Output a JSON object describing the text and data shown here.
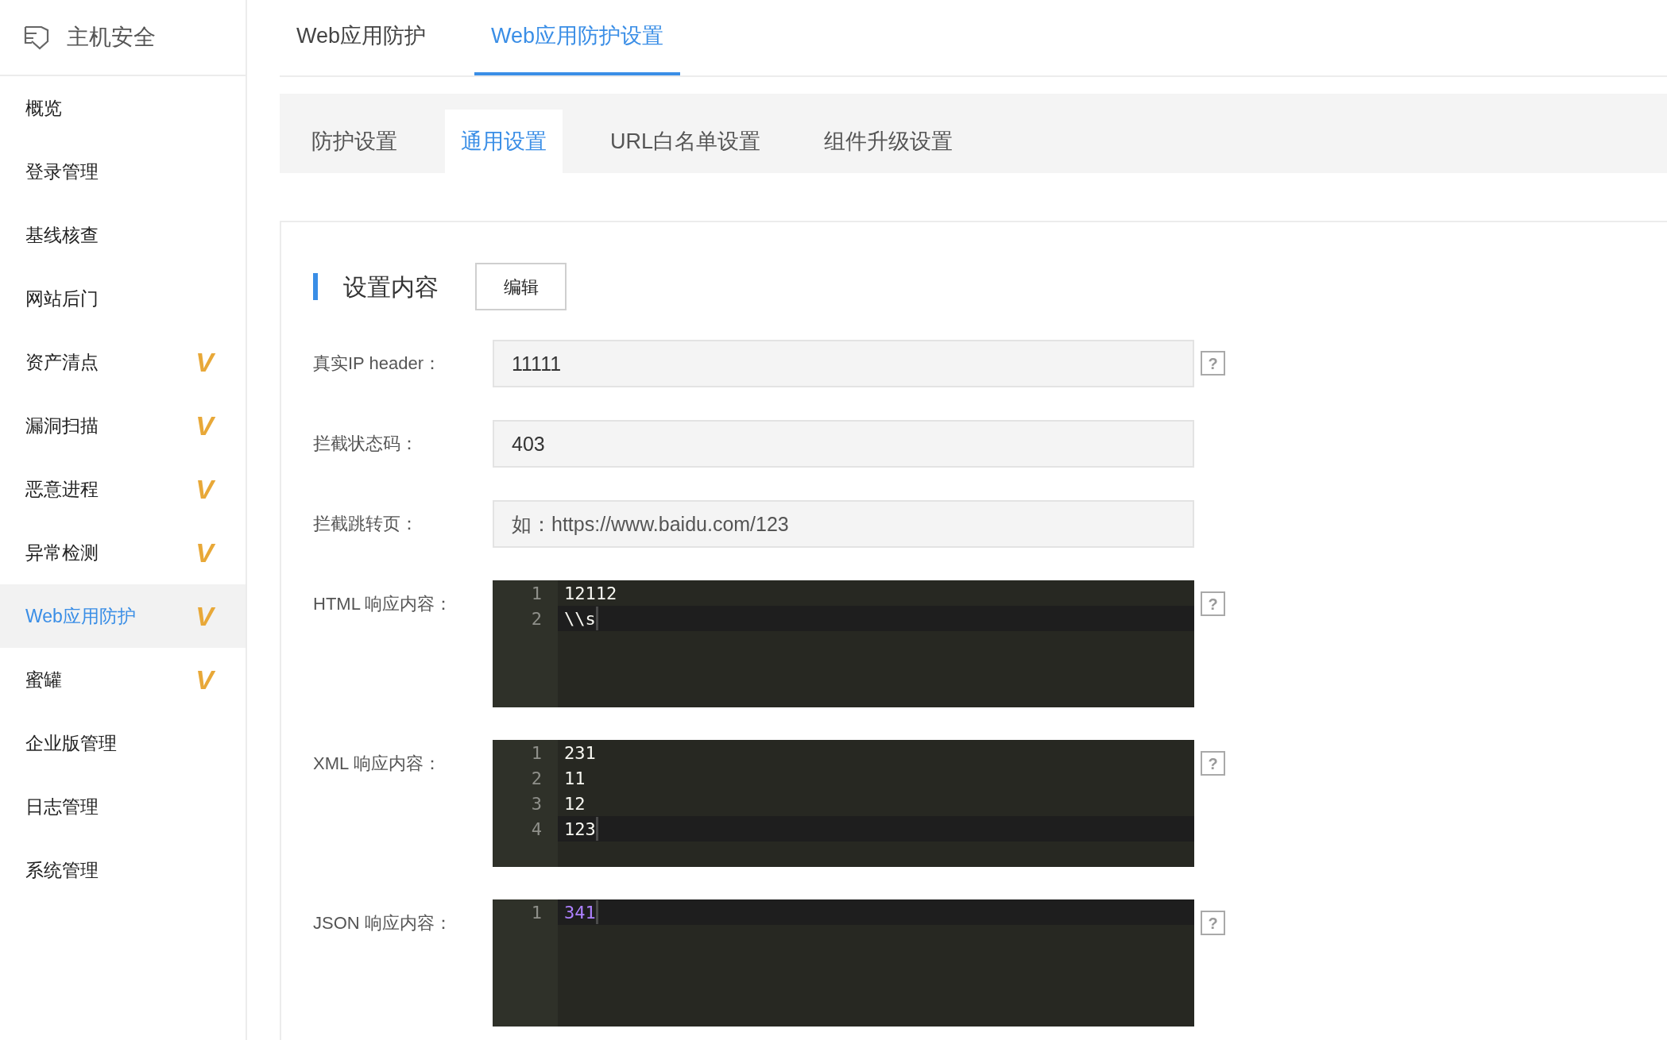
{
  "sidebar": {
    "title": "主机安全",
    "items": [
      {
        "label": "概览",
        "selected": false
      },
      {
        "label": "登录管理",
        "selected": false
      },
      {
        "label": "基线核查",
        "selected": false
      },
      {
        "label": "网站后门",
        "selected": false
      },
      {
        "label": "资产清点",
        "selected": false,
        "badge": "V"
      },
      {
        "label": "漏洞扫描",
        "selected": false,
        "badge": "V"
      },
      {
        "label": "恶意进程",
        "selected": false,
        "badge": "V"
      },
      {
        "label": "异常检测",
        "selected": false,
        "badge": "V"
      },
      {
        "label": "Web应用防护",
        "selected": true,
        "badge": "V"
      },
      {
        "label": "蜜罐",
        "selected": false,
        "badge": "V"
      },
      {
        "label": "企业版管理",
        "selected": false
      },
      {
        "label": "日志管理",
        "selected": false
      },
      {
        "label": "系统管理",
        "selected": false
      }
    ]
  },
  "tabs": [
    {
      "label": "Web应用防护",
      "selected": false
    },
    {
      "label": "Web应用防护设置",
      "selected": true
    }
  ],
  "subtabs": [
    {
      "label": "防护设置",
      "selected": false
    },
    {
      "label": "通用设置",
      "selected": true
    },
    {
      "label": "URL白名单设置",
      "selected": false
    },
    {
      "label": "组件升级设置",
      "selected": false
    }
  ],
  "section": {
    "title": "设置内容",
    "button": "编辑"
  },
  "fields": [
    {
      "kind": "input",
      "label": "真实IP header：",
      "value": "11111",
      "help": "?"
    },
    {
      "kind": "input",
      "label": "拦截状态码：",
      "value": "403"
    },
    {
      "kind": "input",
      "label": "拦截跳转页：",
      "placeholder": "如：https://www.baidu.com/123"
    },
    {
      "kind": "editor",
      "label": "HTML 响应内容：",
      "help": "?",
      "lines": [
        {
          "number": "1",
          "text": "12112",
          "kind": "text",
          "active": false
        },
        {
          "number": "2",
          "text": "\\\\s",
          "kind": "text",
          "active": true
        }
      ]
    },
    {
      "kind": "editor",
      "label": "XML 响应内容：",
      "help": "?",
      "lines": [
        {
          "number": "1",
          "text": "231",
          "kind": "text",
          "active": false
        },
        {
          "number": "2",
          "text": "11",
          "kind": "text",
          "active": false
        },
        {
          "number": "3",
          "text": "12",
          "kind": "text",
          "active": false
        },
        {
          "number": "4",
          "text": "123",
          "kind": "text",
          "active": true
        }
      ]
    },
    {
      "kind": "editor",
      "label": "JSON 响应内容：",
      "help": "?",
      "lines": [
        {
          "number": "1",
          "text": "341",
          "kind": "number",
          "active": true
        }
      ]
    }
  ]
}
